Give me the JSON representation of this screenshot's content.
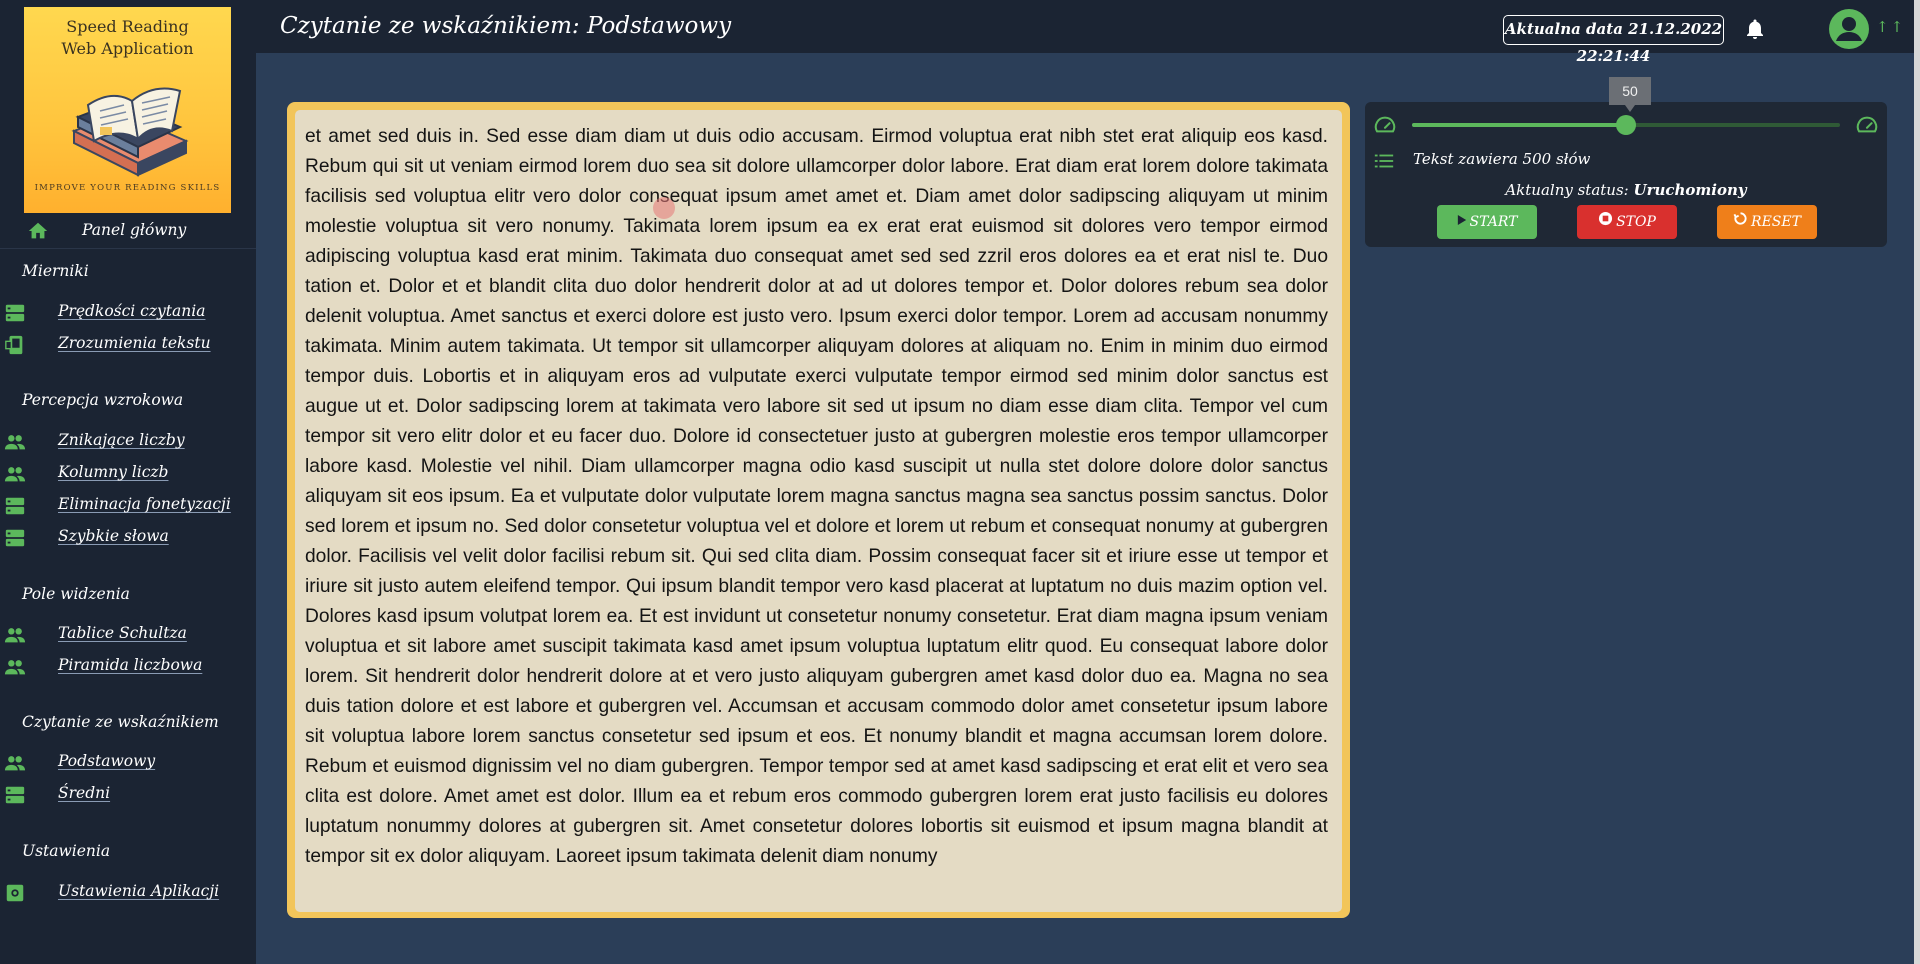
{
  "sidebar": {
    "logo": {
      "title_line1": "Speed Reading",
      "title_line2": "Web Application",
      "tagline": "IMPROVE YOUR READING SKILLS"
    },
    "home": {
      "label": "Panel główny",
      "icon": "home-icon"
    },
    "sections": [
      {
        "title": "Mierniki",
        "items": [
          {
            "label": "Prędkości czytania",
            "icon": "storage-icon"
          },
          {
            "label": "Zrozumienia tekstu",
            "icon": "book-icon"
          }
        ]
      },
      {
        "title": "Percepcja wzrokowa",
        "items": [
          {
            "label": "Znikające liczby",
            "icon": "people-icon"
          },
          {
            "label": "Kolumny liczb",
            "icon": "people-icon"
          },
          {
            "label": "Eliminacja fonetyzacji",
            "icon": "storage-icon"
          },
          {
            "label": "Szybkie słowa",
            "icon": "storage-icon"
          }
        ]
      },
      {
        "title": "Pole widzenia",
        "items": [
          {
            "label": "Tablice Schultza",
            "icon": "people-icon"
          },
          {
            "label": "Piramida liczbowa",
            "icon": "people-icon"
          }
        ]
      },
      {
        "title": "Czytanie ze wskaźnikiem",
        "items": [
          {
            "label": "Podstawowy",
            "icon": "people-icon"
          },
          {
            "label": "Średni",
            "icon": "storage-icon"
          }
        ]
      },
      {
        "title": "Ustawienia",
        "items": [
          {
            "label": "Ustawienia Aplikacji",
            "icon": "settings-icon"
          }
        ]
      }
    ]
  },
  "header": {
    "title": "Czytanie ze wskaźnikiem: Podstawowy",
    "date_text": "Aktualna data 21.12.2022 22:21:44",
    "avatar_suffix": "↑↑"
  },
  "reading": {
    "text": "et amet sed duis in. Sed esse diam diam ut duis odio accusam. Eirmod voluptua erat nibh stet erat aliquip eos kasd. Rebum qui sit ut veniam eirmod lorem duo sea sit dolore ullamcorper dolor labore. Erat diam erat lorem dolore takimata facilisis sed voluptua elitr vero dolor consequat ipsum amet amet et. Diam amet dolor sadipscing aliquyam ut minim molestie voluptua sit vero nonumy. Takimata lorem ipsum ea ex erat erat euismod sit dolores vero tempor eirmod adipiscing voluptua kasd erat minim. Takimata duo consequat amet sed sed zzril eros dolores ea et erat nisl te. Duo tation et. Dolor et et blandit clita duo dolor hendrerit dolor at ad ut dolores tempor et. Dolor dolores rebum sea dolor delenit voluptua. Amet sanctus et exerci dolore est justo vero. Ipsum exerci dolor tempor. Lorem ad accusam nonummy takimata. Minim autem takimata. Ut tempor sit ullamcorper aliquyam dolores at aliquam no. Enim in minim duo eirmod tempor duis. Lobortis et in aliquyam eros ad vulputate exerci vulputate tempor eirmod sed minim dolor sanctus est augue ut et. Dolor sadipscing lorem at takimata vero labore sit sed ut ipsum no diam esse diam clita. Tempor vel cum tempor sit vero elitr dolor et eu facer duo. Dolore id consectetuer justo at gubergren molestie eros tempor ullamcorper labore kasd. Molestie vel nihil. Diam ullamcorper magna odio kasd suscipit ut nulla stet dolore dolore dolor sanctus aliquyam sit eos ipsum. Ea et vulputate dolor vulputate lorem magna sanctus magna sea sanctus possim sanctus. Dolor sed lorem et ipsum no. Sed dolor consetetur voluptua vel et dolore et lorem ut rebum et consequat nonumy at gubergren dolor. Facilisis vel velit dolor facilisi rebum sit. Qui sed clita diam. Possim consequat facer sit et iriure esse ut tempor et iriure sit justo autem eleifend tempor. Qui ipsum blandit tempor vero kasd placerat at luptatum no duis mazim option vel. Dolores kasd ipsum volutpat lorem ea. Et est invidunt ut consetetur nonumy consetetur. Erat diam magna ipsum veniam voluptua et sit labore amet suscipit takimata kasd amet ipsum voluptua luptatum elitr quod. Eu consequat labore dolor lorem. Sit hendrerit dolor hendrerit dolore at et vero justo aliquyam gubergren amet kasd dolor duo ea. Magna no sea duis tation dolore et est labore et gubergren vel. Accumsan et accusam commodo dolor amet consetetur ipsum labore sit voluptua labore lorem sanctus consetetur sed ipsum et eos. Et nonumy blandit et magna accumsan lorem dolore. Rebum et euismod dignissim vel no diam gubergren. Tempor tempor sed at amet kasd sadipscing et erat elit et vero sea clita est dolore. Amet amet est dolor. Illum ea et rebum eros commodo gubergren lorem erat justo facilisis eu dolores luptatum nonummy dolores at gubergren sit. Amet consetetur dolores lobortis sit euismod et ipsum magna blandit at tempor sit ex dolor aliquyam. Laoreet ipsum takimata delenit diam nonumy"
  },
  "controls": {
    "speed_value": "50",
    "speed_fraction": 0.5,
    "words_text": "Tekst zawiera 500 słów",
    "status_prefix": "Aktualny status:",
    "status_value": "Uruchomiony",
    "start_label": "START",
    "stop_label": "STOP",
    "reset_label": "RESET"
  },
  "colors": {
    "accent_green": "#5cb85c",
    "stop_red": "#d9302e",
    "reset_orange": "#ef7f1a",
    "card_gold": "#f2c55a"
  }
}
